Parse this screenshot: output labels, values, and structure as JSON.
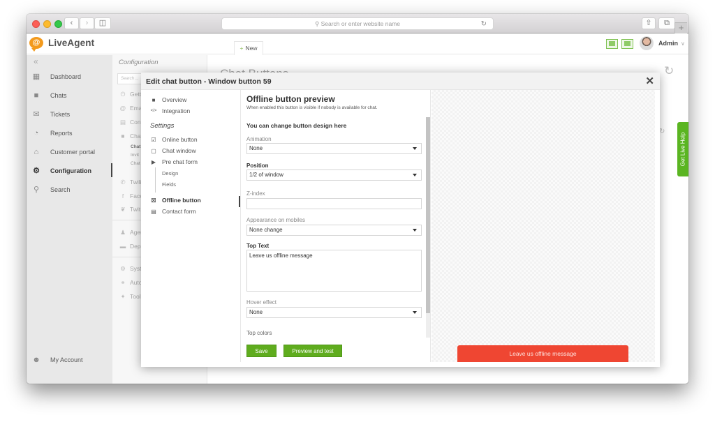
{
  "browser": {
    "address_placeholder": "Search or enter website name",
    "back_icon": "chevron-left",
    "forward_icon": "chevron-right",
    "new_tab_label": "+"
  },
  "app": {
    "logo_text": "LiveAgent",
    "new_button": "New",
    "user_name": "Admin",
    "brand_color": "#f39a1d",
    "accent_green": "#5fac1e"
  },
  "leftnav": {
    "items": [
      {
        "label": "Dashboard",
        "icon": "dashboard-icon"
      },
      {
        "label": "Chats",
        "icon": "chat-icon"
      },
      {
        "label": "Tickets",
        "icon": "envelope-icon"
      },
      {
        "label": "Reports",
        "icon": "pie-chart-icon"
      },
      {
        "label": "Customer portal",
        "icon": "portal-icon"
      },
      {
        "label": "Configuration",
        "icon": "gear-icon",
        "active": true
      },
      {
        "label": "Search",
        "icon": "search-icon"
      }
    ],
    "account": "My Account"
  },
  "config": {
    "title": "Configuration",
    "search_placeholder": "Search ...",
    "items": [
      "Gett",
      "Ema",
      "Cont",
      "Chat",
      "Twili",
      "Face",
      "Twit",
      "Ager",
      "Depa",
      "Syst",
      "Auto",
      "Tool"
    ],
    "subitems": [
      "Chat",
      "Invit",
      "Chat"
    ]
  },
  "page": {
    "title": "Chat Buttons",
    "help_tab": "Get Live Help"
  },
  "dialog": {
    "title": "Edit chat button - Window button 59",
    "nav": {
      "overview": "Overview",
      "integration": "Integration",
      "settings_heading": "Settings",
      "online_button": "Online button",
      "chat_window": "Chat window",
      "pre_chat_form": "Pre chat form",
      "design": "Design",
      "fields": "Fields",
      "offline_button": "Offline button",
      "contact_form": "Contact form"
    },
    "form": {
      "title": "Offline button preview",
      "subtitle": "When enabled this button is visible if nobody is available for chat.",
      "heading": "You can change button design here",
      "animation_label": "Animation",
      "animation_value": "None",
      "position_label": "Position",
      "position_value": "1/2 of window",
      "zindex_label": "Z-index",
      "zindex_value": "",
      "mobiles_label": "Appearance on mobiles",
      "mobiles_value": "None change",
      "top_text_label": "Top Text",
      "top_text_value": "Leave us offline message",
      "hover_label": "Hover effect",
      "hover_value": "None",
      "top_colors_label": "Top colors",
      "save": "Save",
      "preview": "Preview and test"
    },
    "preview_button_text": "Leave us offline message",
    "preview_button_color": "#ef4632"
  }
}
